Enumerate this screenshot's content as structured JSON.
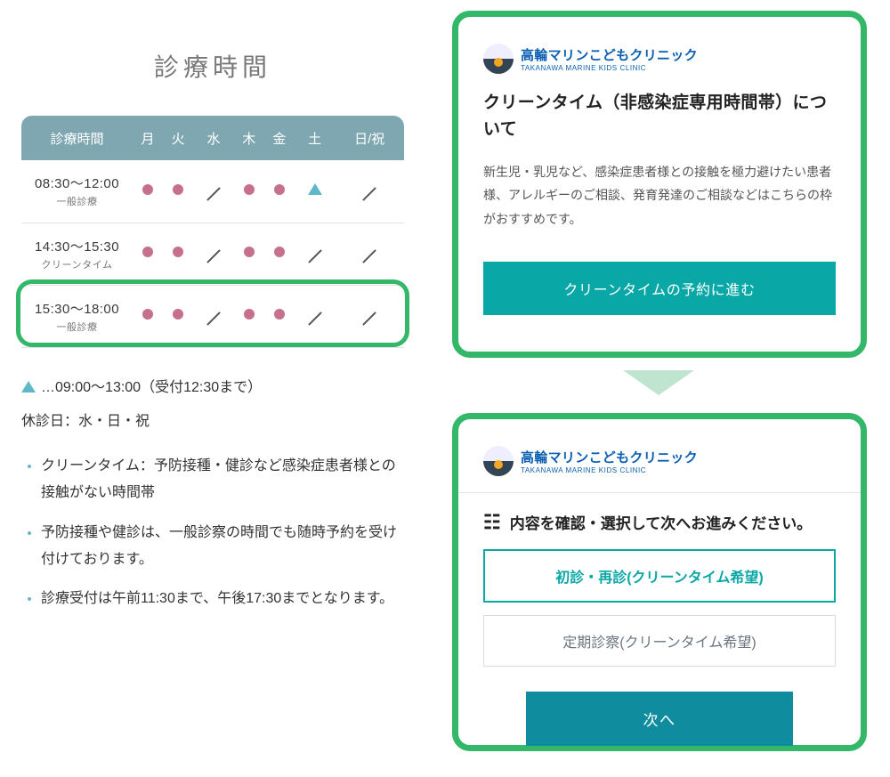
{
  "left": {
    "title": "診療時間",
    "header": {
      "label": "診療時間",
      "days": [
        "月",
        "火",
        "水",
        "木",
        "金",
        "土",
        "日/祝"
      ]
    },
    "rows": [
      {
        "time": "08:30～12:00",
        "sub": "一般診療",
        "cells": [
          "dot",
          "dot",
          "slash",
          "dot",
          "dot",
          "tri",
          "slash"
        ]
      },
      {
        "time": "14:30～15:30",
        "sub": "クリーンタイム",
        "cells": [
          "dot",
          "dot",
          "slash",
          "dot",
          "dot",
          "slash",
          "slash"
        ]
      },
      {
        "time": "15:30～18:00",
        "sub": "一般診療",
        "cells": [
          "dot",
          "dot",
          "slash",
          "dot",
          "dot",
          "slash",
          "slash"
        ]
      }
    ],
    "legend_tri": "…09:00～13:00（受付12:30まで）",
    "closed": "休診日：水・日・祝",
    "notes": [
      "クリーンタイム：予防接種・健診など感染症患者様との接触がない時間帯",
      "予防接種や健診は、一般診察の時間でも随時予約を受け付けております。",
      "診療受付は午前11:30まで、午後17:30までとなります。"
    ]
  },
  "logo": {
    "name": "高輪マリンこどもクリニック",
    "sub": "TAKANAWA MARINE KIDS CLINIC"
  },
  "card1": {
    "heading": "クリーンタイム（非感染症専用時間帯）について",
    "desc": "新生児・乳児など、感染症患者様との接触を極力避けたい患者様、アレルギーのご相談、発育発達のご相談などはこちらの枠がおすすめです。",
    "button": "クリーンタイムの予約に進む"
  },
  "card2": {
    "instruction": "内容を確認・選択して次へお進みください。",
    "option1": "初診・再診(クリーンタイム希望)",
    "option2": "定期診察(クリーンタイム希望)",
    "next": "次へ"
  }
}
